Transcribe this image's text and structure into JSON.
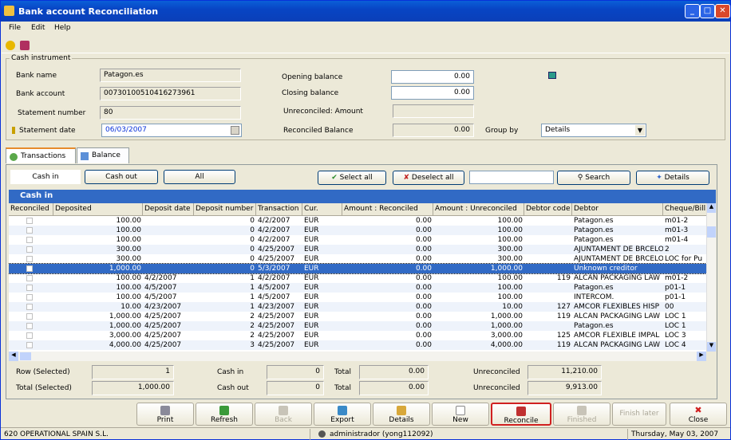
{
  "window": {
    "title": "Bank account Reconciliation"
  },
  "menu": [
    "File",
    "Edit",
    "Help"
  ],
  "cash_instrument": {
    "legend": "Cash instrument",
    "bank_name_label": "Bank name",
    "bank_name": "Patagon.es",
    "bank_account_label": "Bank account",
    "bank_account": "00730100510416273961",
    "statement_number_label": "Statement number",
    "statement_number": "80",
    "statement_date_label": "Statement date",
    "statement_date": "06/03/2007",
    "opening_balance_label": "Opening balance",
    "opening_balance": "0.00",
    "closing_balance_label": "Closing balance",
    "closing_balance": "0.00",
    "unreconciled_amount_label": "Unreconciled: Amount",
    "reconciled_balance_label": "Reconciled Balance",
    "reconciled_balance": "0.00",
    "group_by_label": "Group by",
    "group_by": "Details"
  },
  "tabs": {
    "transactions": "Transactions",
    "balance": "Balance"
  },
  "filters": {
    "cash_in": "Cash in",
    "cash_out": "Cash out",
    "all": "All",
    "select_all": "Select all",
    "deselect_all": "Deselect all",
    "search": "Search",
    "details": "Details"
  },
  "grid": {
    "title": "Cash in",
    "columns": [
      "Reconciled",
      "Deposited",
      "Deposit date",
      "Deposit number",
      "Transaction",
      "Cur.",
      "Amount : Reconciled",
      "Amount : Unreconciled",
      "Debtor code",
      "Debtor",
      "Cheque/Bill of"
    ],
    "rows": [
      {
        "deposited": "100.00",
        "date": "",
        "number": "0",
        "transaction": "4/2/2007",
        "cur": "EUR",
        "reconciled": "0.00",
        "unreconciled": "100.00",
        "code": "",
        "debtor": "Patagon.es",
        "cheque": "m01-2"
      },
      {
        "deposited": "100.00",
        "date": "",
        "number": "0",
        "transaction": "4/2/2007",
        "cur": "EUR",
        "reconciled": "0.00",
        "unreconciled": "100.00",
        "code": "",
        "debtor": "Patagon.es",
        "cheque": "m01-3"
      },
      {
        "deposited": "100.00",
        "date": "",
        "number": "0",
        "transaction": "4/2/2007",
        "cur": "EUR",
        "reconciled": "0.00",
        "unreconciled": "100.00",
        "code": "",
        "debtor": "Patagon.es",
        "cheque": "m01-4"
      },
      {
        "deposited": "300.00",
        "date": "",
        "number": "0",
        "transaction": "4/25/2007",
        "cur": "EUR",
        "reconciled": "0.00",
        "unreconciled": "300.00",
        "code": "",
        "debtor": "AJUNTAMENT DE BRCELON",
        "cheque": "2"
      },
      {
        "deposited": "300.00",
        "date": "",
        "number": "0",
        "transaction": "4/25/2007",
        "cur": "EUR",
        "reconciled": "0.00",
        "unreconciled": "300.00",
        "code": "",
        "debtor": "AJUNTAMENT DE BRCELON",
        "cheque": "LOC for Pu"
      },
      {
        "deposited": "1,000.00",
        "date": "",
        "number": "0",
        "transaction": "5/3/2007",
        "cur": "EUR",
        "reconciled": "0.00",
        "unreconciled": "1,000.00",
        "code": "",
        "debtor": "Unknown creditor",
        "cheque": "",
        "selected": true
      },
      {
        "deposited": "100.00",
        "date": "4/2/2007",
        "number": "1",
        "transaction": "4/2/2007",
        "cur": "EUR",
        "reconciled": "0.00",
        "unreconciled": "100.00",
        "code": "119",
        "debtor": "ALCAN PACKAGING LAW",
        "cheque": "m01-2"
      },
      {
        "deposited": "100.00",
        "date": "4/5/2007",
        "number": "1",
        "transaction": "4/5/2007",
        "cur": "EUR",
        "reconciled": "0.00",
        "unreconciled": "100.00",
        "code": "",
        "debtor": "Patagon.es",
        "cheque": "p01-1"
      },
      {
        "deposited": "100.00",
        "date": "4/5/2007",
        "number": "1",
        "transaction": "4/5/2007",
        "cur": "EUR",
        "reconciled": "0.00",
        "unreconciled": "100.00",
        "code": "",
        "debtor": "INTERCOM.",
        "cheque": "p01-1"
      },
      {
        "deposited": "10.00",
        "date": "4/23/2007",
        "number": "1",
        "transaction": "4/23/2007",
        "cur": "EUR",
        "reconciled": "0.00",
        "unreconciled": "10.00",
        "code": "127",
        "debtor": "AMCOR FLEXIBLES HISP",
        "cheque": "00"
      },
      {
        "deposited": "1,000.00",
        "date": "4/25/2007",
        "number": "2",
        "transaction": "4/25/2007",
        "cur": "EUR",
        "reconciled": "0.00",
        "unreconciled": "1,000.00",
        "code": "119",
        "debtor": "ALCAN PACKAGING LAW",
        "cheque": "LOC 1"
      },
      {
        "deposited": "1,000.00",
        "date": "4/25/2007",
        "number": "2",
        "transaction": "4/25/2007",
        "cur": "EUR",
        "reconciled": "0.00",
        "unreconciled": "1,000.00",
        "code": "",
        "debtor": "Patagon.es",
        "cheque": "LOC 1"
      },
      {
        "deposited": "3,000.00",
        "date": "4/25/2007",
        "number": "2",
        "transaction": "4/25/2007",
        "cur": "EUR",
        "reconciled": "0.00",
        "unreconciled": "3,000.00",
        "code": "125",
        "debtor": "AMCOR FLEXIBLE IMPAL",
        "cheque": "LOC 3"
      },
      {
        "deposited": "4,000.00",
        "date": "4/25/2007",
        "number": "3",
        "transaction": "4/25/2007",
        "cur": "EUR",
        "reconciled": "0.00",
        "unreconciled": "4,000.00",
        "code": "119",
        "debtor": "ALCAN PACKAGING LAW",
        "cheque": "LOC 4"
      }
    ]
  },
  "summary": {
    "row_selected_label": "Row (Selected)",
    "row_selected": "1",
    "total_selected_label": "Total (Selected)",
    "total_selected": "1,000.00",
    "cash_in_label": "Cash in",
    "cash_in": "0",
    "cash_out_label": "Cash out",
    "cash_out": "0",
    "total_label": "Total",
    "total1": "0.00",
    "total2": "0.00",
    "unreconciled_label": "Unreconciled",
    "unreconciled1": "11,210.00",
    "unreconciled2": "9,913.00"
  },
  "buttons": {
    "print": "Print",
    "refresh": "Refresh",
    "back": "Back",
    "export": "Export",
    "details": "Details",
    "new": "New",
    "reconcile": "Reconcile",
    "finished": "Finished",
    "finish_later": "Finish later",
    "close": "Close"
  },
  "status": {
    "company": "620 OPERATIONAL SPAIN S.L.",
    "user": "administrador (yong112092)",
    "date": "Thursday, May 03, 2007"
  }
}
